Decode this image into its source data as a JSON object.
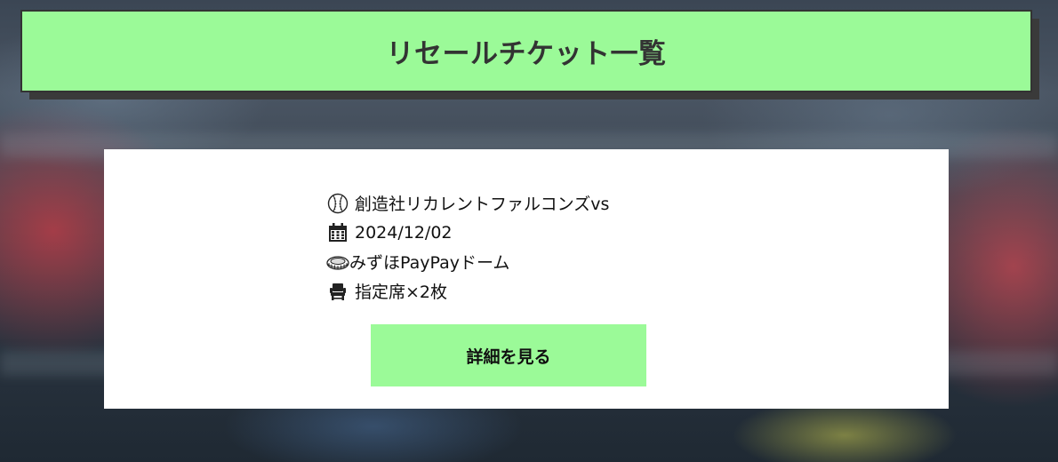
{
  "header": {
    "title": "リセールチケット一覧"
  },
  "ticket": {
    "match": "創造社リカレントファルコンズvs",
    "date": "2024/12/02",
    "venue": "みずほPayPayドーム",
    "seat": "指定席×2枚",
    "match_icon": "baseball-icon",
    "date_icon": "calendar-icon",
    "venue_icon": "stadium-icon",
    "seat_icon": "seat-icon"
  },
  "actions": {
    "details_label": "詳細を見る"
  },
  "colors": {
    "accent": "#9bfa98",
    "header_border": "#333333",
    "card_background": "#ffffff"
  }
}
